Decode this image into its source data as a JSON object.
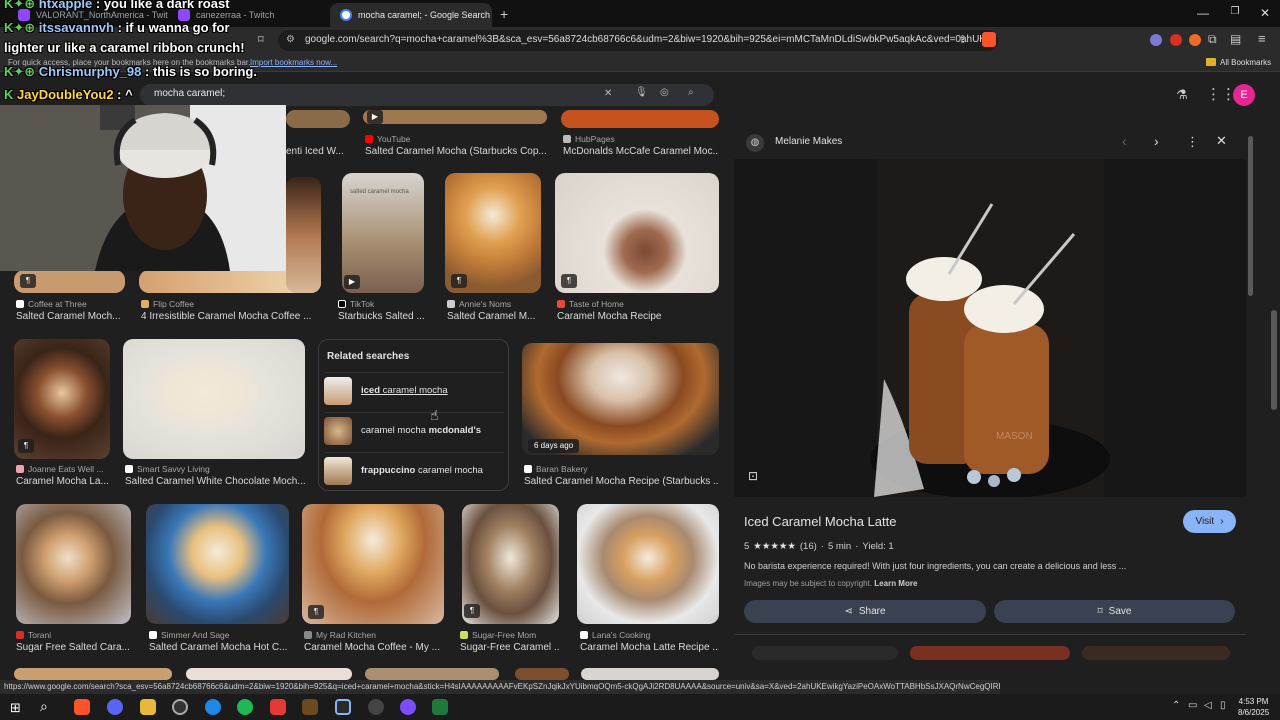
{
  "tabs": [
    {
      "title": "VALORANT_NorthAmerica - Twit",
      "color": "#9146ff"
    },
    {
      "title": "canezerraa - Twitch",
      "color": "#9146ff"
    },
    {
      "title": "mocha caramel; - Google Search",
      "color": "#4285f4"
    }
  ],
  "address_bar": {
    "url": "google.com/search?q=mocha+caramel%3B&sca_esv=56a8724cb68766c6&udm=2&biw=1920&bih=925&ei=mMCTaMnDLdiSwbkPw5aqkAc&ved=0ahUK..."
  },
  "bookmarks": {
    "hint": "For quick access, place your bookmarks here on the bookmarks bar.",
    "import_link": "Import bookmarks now...",
    "all_label": "All Bookmarks"
  },
  "search": {
    "query": "mocha caramel;"
  },
  "account_initial": "E",
  "chat": [
    {
      "user": "htxapple",
      "message": " : you like a dark roast"
    },
    {
      "user": "itssavannvh",
      "message": " : if u wanna go for"
    },
    {
      "user": "",
      "message": "lighter ur like a caramel ribbon crunch!"
    },
    {
      "user": "Chrismurphy_98",
      "message": " : this is so boring."
    },
    {
      "user": "JayDoubleYou2",
      "message": " : ^"
    }
  ],
  "results": [
    {
      "source": "",
      "title": "enti Iced W..."
    },
    {
      "source": "YouTube",
      "title": "Salted Caramel Mocha (Starbucks Cop..."
    },
    {
      "source": "HubPages",
      "title": "McDonalds McCafe Caramel Moc..."
    },
    {
      "source": "Coffee at Three",
      "title": "Salted Caramel Moch..."
    },
    {
      "source": "Flip Coffee",
      "title": "4 Irresistible Caramel Mocha Coffee ..."
    },
    {
      "source": "TikTok",
      "title": "Starbucks Salted ..."
    },
    {
      "source": "Annie's Noms",
      "title": "Salted Caramel M..."
    },
    {
      "source": "Taste of Home",
      "title": "Caramel Mocha Recipe"
    },
    {
      "source": "Joanne Eats Well ...",
      "title": "Caramel Mocha La..."
    },
    {
      "source": "Smart Savvy Living",
      "title": "Salted Caramel White Chocolate Moch..."
    },
    {
      "source": "Baran Bakery",
      "title": "Salted Caramel Mocha Recipe (Starbucks ..."
    },
    {
      "source": "Torani",
      "title": "Sugar Free Salted Cara..."
    },
    {
      "source": "Simmer And Sage",
      "title": "Salted Caramel Mocha Hot C..."
    },
    {
      "source": "My Rad Kitchen",
      "title": "Caramel Mocha Coffee - My ..."
    },
    {
      "source": "Sugar-Free Mom",
      "title": "Sugar-Free Caramel ..."
    },
    {
      "source": "Lana's Cooking",
      "title": "Caramel Mocha Latte Recipe ..."
    }
  ],
  "thumb_overlay": {
    "tiktok_text": "salted caramel mocha",
    "age_badge": "6 days ago"
  },
  "related": {
    "heading": "Related searches",
    "items": [
      {
        "bold": "iced",
        "rest": " caramel mocha"
      },
      {
        "plain": "caramel mocha ",
        "bold": "mcdonald's"
      },
      {
        "bold": "frappuccino",
        "rest": " caramel mocha"
      }
    ]
  },
  "panel": {
    "source_name": "Melanie Makes",
    "title": "Iced Caramel Mocha Latte",
    "visit_label": "Visit",
    "rating": "5",
    "stars": "★★★★★",
    "review_count": "(16)",
    "time": "5 min",
    "yield": "Yield: 1",
    "description": "No barista experience required! With just four ingredients, you can create a delicious and less ...",
    "copyright": "Images may be subject to copyright.",
    "learn_more": "Learn More",
    "share_label": "Share",
    "save_label": "Save",
    "jar_text": "MASON"
  },
  "status_url": "https://www.google.com/search?sca_esv=56a8724cb68766c6&udm=2&biw=1920&bih=925&q=iced+caramel+mocha&stick=H4sIAAAAAAAAAFvEKpSZnJqikJxYUibmqOQm5-ckQgAJi2RD8UAAAA&source=univ&sa=X&ved=2ahUKEwikgYaziPeOAxWoTTABHbSsJXAQrNwCegQIRRAA",
  "clock": {
    "time": "4:53 PM",
    "date": "8/6/2025"
  }
}
